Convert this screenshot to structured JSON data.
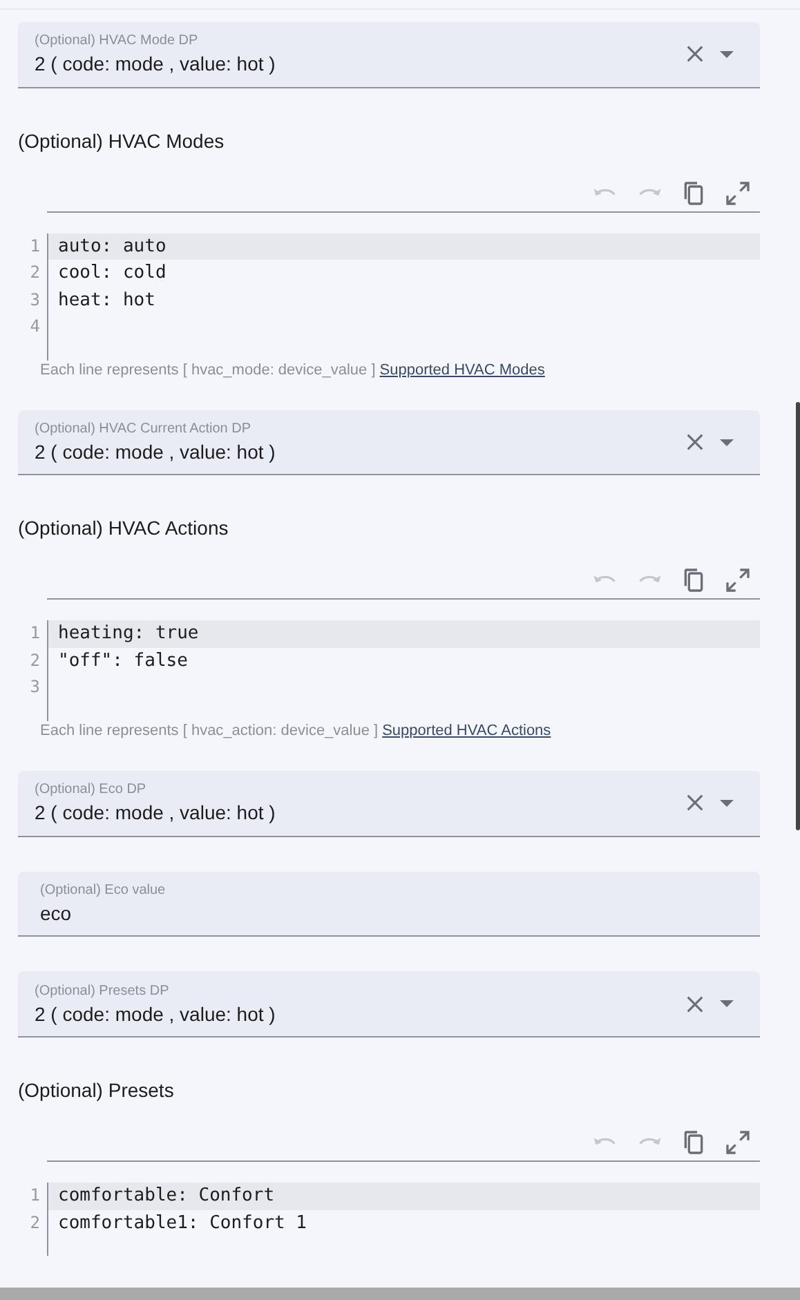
{
  "sections": [
    {
      "kind": "select",
      "label": "(Optional) HVAC Mode DP",
      "value": "2 ( code: mode , value: hot )"
    },
    {
      "kind": "editor",
      "title": "(Optional) HVAC Modes",
      "toolbar": [
        {
          "kind": "undo",
          "disabled": true
        },
        {
          "kind": "redo",
          "disabled": true
        },
        {
          "kind": "copy",
          "disabled": false
        },
        {
          "kind": "expand",
          "disabled": false
        }
      ],
      "lines": [
        {
          "number": "1",
          "text": "auto: auto",
          "selected": true
        },
        {
          "number": "2",
          "text": "cool: cold",
          "selected": false
        },
        {
          "number": "3",
          "text": "heat: hot",
          "selected": false
        },
        {
          "number": "4",
          "selected": false
        }
      ],
      "helper": "Each line represents [ hvac_mode: device_value ]",
      "link": "Supported HVAC Modes"
    },
    {
      "kind": "select",
      "label": "(Optional) HVAC Current Action DP",
      "value": "2 ( code: mode , value: hot )"
    },
    {
      "kind": "editor",
      "title": "(Optional) HVAC Actions",
      "toolbar": [
        {
          "kind": "undo",
          "disabled": true
        },
        {
          "kind": "redo",
          "disabled": true
        },
        {
          "kind": "copy",
          "disabled": false
        },
        {
          "kind": "expand",
          "disabled": false
        }
      ],
      "lines": [
        {
          "number": "1",
          "text": "heating: true",
          "selected": true
        },
        {
          "number": "2",
          "text": "\"off\": false",
          "selected": false
        },
        {
          "number": "3",
          "selected": false
        }
      ],
      "helper": "Each line represents [ hvac_action: device_value ]",
      "link": "Supported HVAC Actions"
    },
    {
      "kind": "select",
      "label": "(Optional) Eco DP",
      "value": "2 ( code: mode , value: hot )"
    },
    {
      "kind": "text",
      "label": "(Optional) Eco value",
      "value": "eco"
    },
    {
      "kind": "select",
      "label": "(Optional) Presets DP",
      "value": "2 ( code: mode , value: hot )"
    },
    {
      "kind": "editor",
      "title": "(Optional) Presets",
      "toolbar": [
        {
          "kind": "undo",
          "disabled": true
        },
        {
          "kind": "redo",
          "disabled": true
        },
        {
          "kind": "copy",
          "disabled": false
        },
        {
          "kind": "expand",
          "disabled": false
        }
      ],
      "lines": [
        {
          "number": "1",
          "text": "comfortable: Confort",
          "selected": true
        },
        {
          "number": "2",
          "text": "comfortable1: Confort 1",
          "selected": false
        }
      ]
    }
  ]
}
